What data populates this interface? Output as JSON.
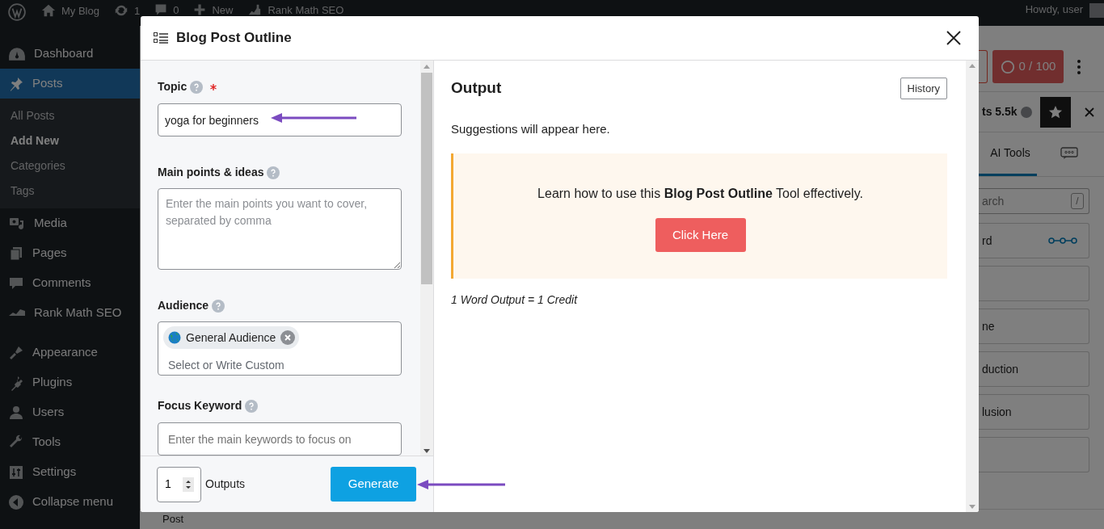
{
  "admin_bar": {
    "items": [
      {
        "kind": "wp"
      },
      {
        "kind": "home",
        "label": "My Blog"
      },
      {
        "kind": "updates",
        "label": "1"
      },
      {
        "kind": "comments",
        "label": "0"
      },
      {
        "kind": "new",
        "label": "New"
      },
      {
        "kind": "rankmath",
        "label": "Rank Math SEO"
      }
    ],
    "greeting": "Howdy, user"
  },
  "sidebar": {
    "items": [
      {
        "label": "Dashboard",
        "selected": false
      },
      {
        "label": "Posts",
        "selected": true,
        "children": [
          {
            "label": "All Posts",
            "selected": false
          },
          {
            "label": "Add New",
            "selected": true
          },
          {
            "label": "Categories",
            "selected": false
          },
          {
            "label": "Tags",
            "selected": false
          }
        ]
      },
      {
        "label": "Media",
        "selected": false
      },
      {
        "label": "Pages",
        "selected": false
      },
      {
        "label": "Comments",
        "selected": false
      },
      {
        "label": "Rank Math SEO",
        "selected": false
      },
      {
        "label": "Appearance",
        "selected": false
      },
      {
        "label": "Plugins",
        "selected": false
      },
      {
        "label": "Users",
        "selected": false
      },
      {
        "label": "Tools",
        "selected": false
      },
      {
        "label": "Settings",
        "selected": false
      },
      {
        "label": "Collapse menu",
        "selected": false
      }
    ]
  },
  "editor": {
    "footer": "Post"
  },
  "right_panel": {
    "credits": "0 / 100",
    "score": "ts 5.5k",
    "tabs": [
      {
        "label": "AI Tools",
        "selected": true
      },
      {
        "kind": "icon",
        "selected": false
      }
    ],
    "search_placeholder": "arch",
    "search_key": "/",
    "tools": [
      {
        "kind": "flow",
        "label": "rd"
      },
      {
        "kind": "blank"
      },
      {
        "kind": "text",
        "label": "ne"
      },
      {
        "kind": "text",
        "label": "duction"
      },
      {
        "kind": "text",
        "label": "lusion"
      },
      {
        "kind": "blank"
      }
    ]
  },
  "modal": {
    "title": "Blog Post Outline",
    "fields": [
      {
        "kind": "input",
        "label": "Topic",
        "required": true,
        "value": "yoga for beginners"
      },
      {
        "kind": "textarea",
        "label": "Main points & ideas",
        "placeholder": "Enter the main points you want to cover, separated by comma"
      },
      {
        "kind": "tags",
        "label": "Audience",
        "tags": [
          "General Audience"
        ],
        "placeholder": "Select or Write Custom"
      },
      {
        "kind": "input",
        "label": "Focus Keyword",
        "placeholder": "Enter the main keywords to focus on"
      }
    ],
    "outputs": {
      "value": "1",
      "label": "Outputs"
    },
    "generate": "Generate",
    "output": {
      "heading": "Output",
      "history": "History",
      "suggestion": "Suggestions will appear here.",
      "tip": "Learn how to use this **Blog Post Outline** Tool effectively.",
      "cta": "Click Here",
      "credit": "1 Word Output = 1 Credit"
    }
  }
}
